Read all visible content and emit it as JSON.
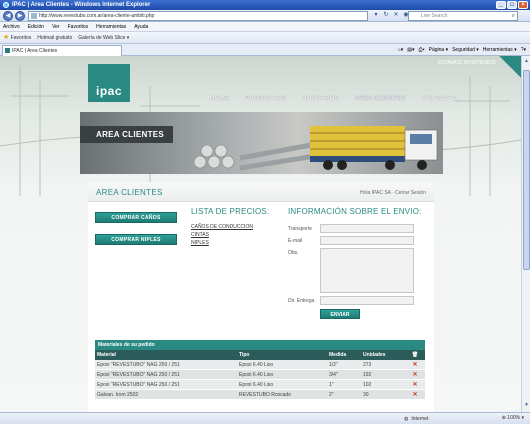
{
  "window": {
    "title": "IPAC | Area Clientes - Windows Internet Explorer",
    "minimize": "_",
    "maximize": "□",
    "close": "×"
  },
  "addressbar": {
    "url": "http://www.revestubo.com.ar/area-cliente-ambiti.php",
    "search_placeholder": "Live Search"
  },
  "menu": [
    "Archivo",
    "Edición",
    "Ver",
    "Favoritos",
    "Herramientas",
    "Ayuda"
  ],
  "favorites": {
    "label": "Favoritos",
    "items": [
      "Hotmail gratuito",
      "Galería de Web Slice ▾"
    ]
  },
  "tab": {
    "label": "IPAC | Area Clientes"
  },
  "commandbar": [
    "Página ▾",
    "Seguridad ▾",
    "Herramientas ▾",
    "?▾"
  ],
  "site": {
    "logo": "ipac",
    "top_link": "ESTAMOS INVIRTIENDO",
    "nav": [
      "HOME",
      "PRODUCTOS",
      "NOSOTROS",
      "AREA CLIENTES",
      "CONTACTO"
    ],
    "banner_title": "AREA CLIENTES"
  },
  "content": {
    "area_title": "AREA CLIENTES",
    "greeting": "Hola IPAC SA · Cerrar Sesión",
    "buttons": {
      "comprar_canos": "COMPRAR CAÑOS",
      "comprar_niples": "COMPRAR NIPLES"
    },
    "price_list": {
      "title": "LISTA DE PRECIOS:",
      "links": [
        "CAÑOS DE CONDUCCION",
        "CINTAS",
        "NIPLES"
      ]
    },
    "shipping": {
      "title": "INFORMACIÓN SOBRE EL ENVIO:",
      "transporte": "Transporte",
      "email": "E-mail",
      "obs": "Obs.",
      "dir_entrega": "Dir. Entrega",
      "send": "ENVIAR"
    }
  },
  "orders": {
    "caption": "Materiales de su pedido",
    "headers": [
      "Material",
      "Tipo",
      "Medida",
      "Unidades",
      "🗑"
    ],
    "rows": [
      [
        "Epoxi \"REVESTUBO\" NAG 250 / 251",
        "Epoxi 6.40 Liso",
        "1/2\"",
        "273"
      ],
      [
        "Epoxi \"REVESTUBO\" NAG 250 / 251",
        "Epoxi 6.40 Liso",
        "3/4\"",
        "192"
      ],
      [
        "Epoxi \"REVESTUBO\" NAG 250 / 251",
        "Epoxi 6.40 Liso",
        "1\"",
        "102"
      ],
      [
        "Galvan. Irom 2502",
        "REVESTUBO Roscado",
        "2\"",
        "30"
      ]
    ],
    "delete_icon": "✕"
  },
  "status": {
    "zone": "Internet",
    "zoom": "100%"
  }
}
